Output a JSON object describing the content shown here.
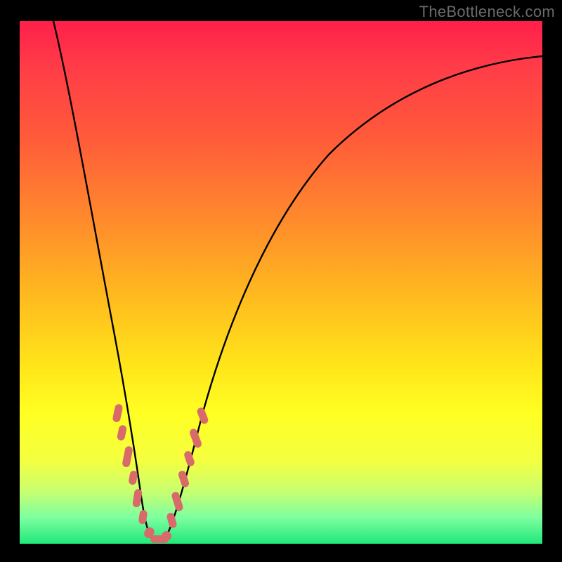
{
  "watermark": "TheBottleneck.com",
  "colors": {
    "frame_bg": "#000000",
    "gradient_top": "#ff1f4a",
    "gradient_bottom": "#20e87a",
    "curve": "#000000",
    "bead": "#d86a6a"
  },
  "chart_data": {
    "type": "line",
    "title": "",
    "xlabel": "",
    "ylabel": "",
    "xlim": [
      0,
      100
    ],
    "ylim": [
      0,
      100
    ],
    "grid": false,
    "note": "Bottleneck-style V curve. y ≈ 100 * |x - x_min| / span, asymmetric sides, minimum near x≈24. Axes and ticks not shown in original.",
    "series": [
      {
        "name": "left_branch",
        "x": [
          6.5,
          8,
          10,
          12,
          14,
          16,
          18,
          20,
          21,
          22,
          23,
          24
        ],
        "y": [
          100,
          90,
          76,
          62,
          48,
          37,
          27,
          18,
          12,
          7,
          3,
          0
        ]
      },
      {
        "name": "right_branch",
        "x": [
          24,
          25,
          26,
          28,
          30,
          34,
          40,
          48,
          58,
          70,
          84,
          100
        ],
        "y": [
          0,
          3,
          7,
          15,
          22,
          34,
          48,
          60,
          70,
          78,
          84,
          89
        ]
      }
    ],
    "beads": {
      "note": "Salmon segments overlaid on curve near the minimum",
      "left": [
        {
          "x": 18.5,
          "y": 25
        },
        {
          "x": 19.2,
          "y": 21
        },
        {
          "x": 20.2,
          "y": 16
        },
        {
          "x": 20.8,
          "y": 12.5
        },
        {
          "x": 21.6,
          "y": 8.5
        },
        {
          "x": 22.3,
          "y": 5
        }
      ],
      "bottom": [
        {
          "x": 23.2,
          "y": 1.5
        },
        {
          "x": 24.0,
          "y": 0.5
        },
        {
          "x": 25.0,
          "y": 0.5
        },
        {
          "x": 26.5,
          "y": 1.5
        }
      ],
      "right": [
        {
          "x": 27.8,
          "y": 5
        },
        {
          "x": 28.8,
          "y": 9
        },
        {
          "x": 29.8,
          "y": 13
        },
        {
          "x": 30.7,
          "y": 17
        },
        {
          "x": 31.6,
          "y": 21
        },
        {
          "x": 32.5,
          "y": 25
        }
      ]
    }
  }
}
